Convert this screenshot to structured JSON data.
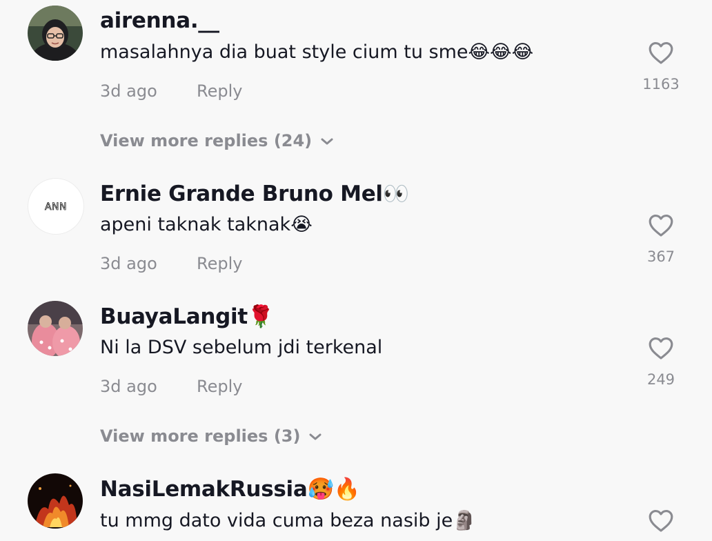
{
  "comments": [
    {
      "username": "airenna.__",
      "text": "masalahnya dia buat style cium tu sme😂😂😂",
      "time": "3d ago",
      "reply_label": "Reply",
      "likes": "1163",
      "view_more": "View more replies (24)"
    },
    {
      "username": "Ernie Grande Bruno Mel👀",
      "avatar_text": "ANN",
      "text": "apeni taknak taknak😭",
      "time": "3d ago",
      "reply_label": "Reply",
      "likes": "367"
    },
    {
      "username": "BuayaLangit🌹",
      "text": "Ni la DSV sebelum jdi terkenal",
      "time": "3d ago",
      "reply_label": "Reply",
      "likes": "249",
      "view_more": "View more replies (3)"
    },
    {
      "username": "NasiLemakRussia🥵🔥",
      "text": "tu mmg dato vida cuma beza nasib je🗿"
    }
  ],
  "colors": {
    "background": "#f8f8f8",
    "primary_text": "#161823",
    "secondary_text": "#8a8b91"
  },
  "icons": {
    "like": "heart-outline-icon",
    "expand": "chevron-down-icon"
  }
}
